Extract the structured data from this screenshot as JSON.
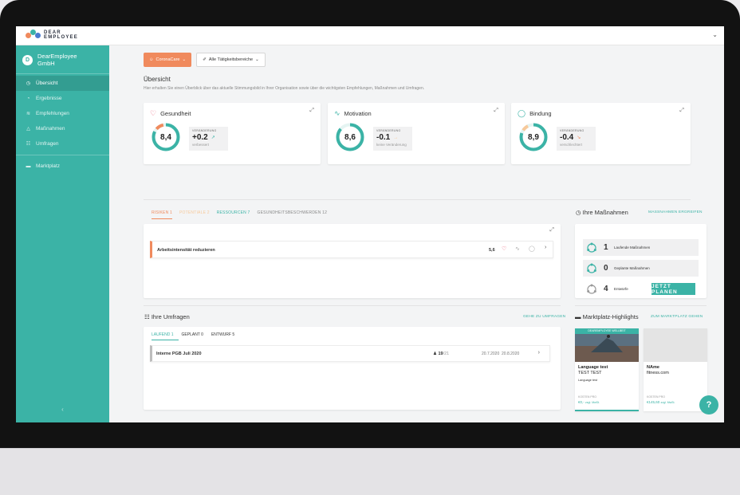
{
  "app": {
    "logo_line1": "DEAR",
    "logo_line2": "EMPLOYEE"
  },
  "colors": {
    "teal": "#3bb3a6",
    "orange": "#f08a5d",
    "peach": "#f7c99a"
  },
  "sidebar": {
    "org_initial": "D",
    "org_name_1": "DearEmployee",
    "org_name_2": "GmbH",
    "items": [
      {
        "label": "Übersicht",
        "icon": "clock-icon",
        "glyph": "◷"
      },
      {
        "label": "Ergebnisse",
        "icon": "chart-icon",
        "glyph": "◔"
      },
      {
        "label": "Empfehlungen",
        "icon": "wifi-icon",
        "glyph": "≋"
      },
      {
        "label": "Maßnahmen",
        "icon": "bell-icon",
        "glyph": "△"
      },
      {
        "label": "Umfragen",
        "icon": "clipboard-icon",
        "glyph": "☷"
      },
      {
        "label": "Marktplatz",
        "icon": "card-icon",
        "glyph": "▬"
      }
    ],
    "collapse_glyph": "‹"
  },
  "toolbar": {
    "corona_label": "CoronaCare",
    "corona_glyph": "☺",
    "area_label": "Alle Tätigkeitsbereiche",
    "area_glyph": "✐",
    "chevron": "⌄"
  },
  "overview": {
    "title": "Übersicht",
    "desc": "Hier erhalten Sie einen Überblick über das aktuelle Stimmungsbild in Ihrer Organisation sowie über die wichtigsten Empfehlungen, Maßnahmen und Umfragen."
  },
  "kpis": [
    {
      "title": "Gesundheit",
      "icon": "heart-icon",
      "glyph": "♡",
      "icon_color": "#e85d75",
      "value": "8,4",
      "score": 8.4,
      "change_label": "VERÄNDERUNG",
      "change": "+0.2",
      "change_text": "verbessert",
      "arrow": "↗",
      "arrow_color": "#3bb3a6"
    },
    {
      "title": "Motivation",
      "icon": "pulse-icon",
      "glyph": "∿",
      "icon_color": "#3bb3a6",
      "value": "8,6",
      "score": 8.6,
      "change_label": "VERÄNDERUNG",
      "change": "-0.1",
      "change_text": "keine Veränderung",
      "arrow": "→",
      "arrow_color": "#f7c99a"
    },
    {
      "title": "Bindung",
      "icon": "ring-icon",
      "glyph": "◯",
      "icon_color": "#3bb3a6",
      "value": "8,9",
      "score": 8.9,
      "change_label": "VERÄNDERUNG",
      "change": "-0.4",
      "change_text": "verschlechtert",
      "arrow": "↘",
      "arrow_color": "#f08a5d"
    }
  ],
  "expand_glyph": "⤢",
  "risk_tabs": {
    "risiken": "RISIKEN 1",
    "potentiale": "POTENTIALE 2",
    "ressourcen": "RESSOURCEN 7",
    "beschwerden": "GESUNDHEITSBESCHWERDEN 12"
  },
  "risk_row": {
    "label": "Arbeitsintensität reduzieren",
    "score": "5,6",
    "chevron": "›"
  },
  "massnahmen": {
    "title": "Ihre Maßnahmen",
    "title_glyph": "◷",
    "link": "MASSNAHMEN ERGREIFEN",
    "rows": [
      {
        "count": "1",
        "label": "Laufende Maßnahmen"
      },
      {
        "count": "0",
        "label": "Geplante Maßnahmen"
      },
      {
        "count": "4",
        "label": "Entwürfe"
      }
    ],
    "plan_button": "JETZT PLANEN"
  },
  "umfragen": {
    "title": "Ihre Umfragen",
    "title_glyph": "☷",
    "link": "GEHE ZU UMFRAGEN",
    "tabs": {
      "laufend": "LAUFEND 1",
      "geplant": "GEPLANT 0",
      "entwurf": "ENTWURF 5"
    },
    "row": {
      "name": "Interne PGB Juli 2020",
      "count_strong": "19",
      "count_total": "/21",
      "start": "20.7.2020",
      "end": "20.8.2020",
      "chevron": "›"
    }
  },
  "marktplatz": {
    "title": "Marktplatz-Highlights",
    "title_glyph": "▬",
    "link": "ZUM MARKTPLATZ GEHEN",
    "cards": [
      {
        "badge": "DEAREMPLOYEE WELLBEIT",
        "title": "Language test",
        "subtitle": "TEST TEST",
        "desc": "Language test",
        "cost_label": "KOSTEN PRO",
        "price": "€0,-",
        "price_unit": "zzgl. MwSt."
      },
      {
        "title": "NAme",
        "subtitle": "fitness.com",
        "cost_label": "KOSTEN PRO",
        "price": "€145,60",
        "price_unit": "zzgl. MwSt."
      }
    ]
  },
  "help_label": "?"
}
